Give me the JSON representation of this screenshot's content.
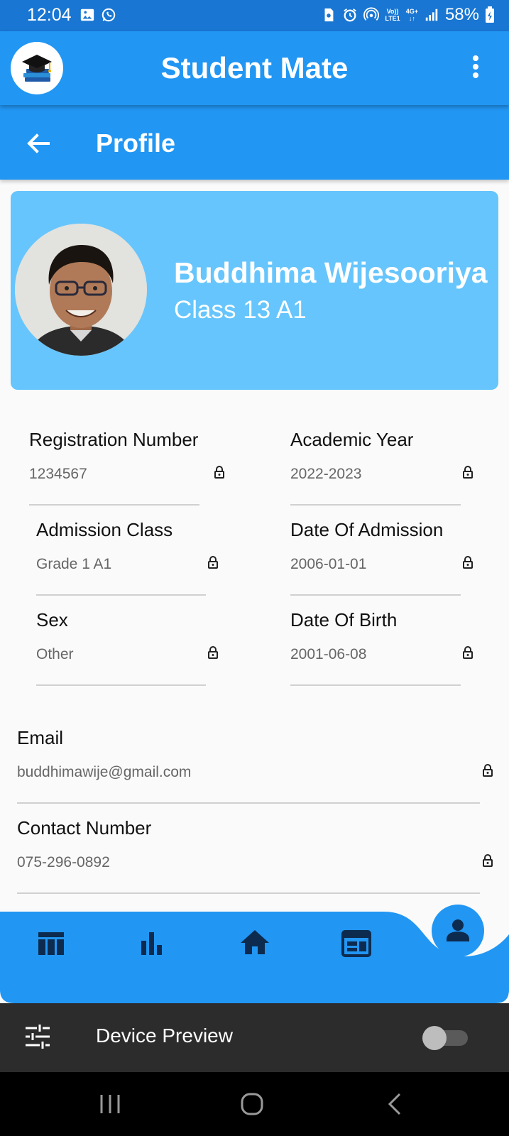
{
  "status_bar": {
    "time": "12:04",
    "left_icons": [
      "gallery-icon",
      "whatsapp-icon"
    ],
    "right_icons": [
      "sim-icon",
      "alarm-icon",
      "hotspot-icon",
      "volte-icon",
      "network-4g-icon",
      "signal-icon"
    ],
    "volte_label_top": "Vo))",
    "volte_label_bottom": "LTE1",
    "network_label": "4G+",
    "battery": "58%"
  },
  "app_bar": {
    "title": "Student Mate",
    "logo_icon": "graduation-cap-books-icon",
    "menu_icon": "more-vert-icon"
  },
  "profile_bar": {
    "title": "Profile",
    "back_icon": "arrow-back-icon"
  },
  "profile_card": {
    "name": "Buddhima Wijesooriya",
    "class": "Class 13 A1",
    "background": "#66c5fc"
  },
  "fields": {
    "registration_number": {
      "label": "Registration Number",
      "value": "1234567"
    },
    "academic_year": {
      "label": "Academic Year",
      "value": "2022-2023"
    },
    "admission_class": {
      "label": "Admission Class",
      "value": "Grade 1 A1"
    },
    "date_of_admission": {
      "label": "Date Of Admission",
      "value": "2006-01-01"
    },
    "sex": {
      "label": "Sex",
      "value": "Other"
    },
    "date_of_birth": {
      "label": "Date Of Birth",
      "value": "2001-06-08"
    },
    "email": {
      "label": "Email",
      "value": "buddhimawije@gmail.com"
    },
    "contact_number": {
      "label": "Contact Number",
      "value": "075-296-0892"
    }
  },
  "bottom_nav": {
    "items": [
      "table-icon",
      "bar-chart-icon",
      "home-icon",
      "calendar-icon",
      "person-icon"
    ],
    "active": "person-icon",
    "color": "#2196f3",
    "icon_color": "#0d2b4f"
  },
  "device_preview": {
    "label": "Device Preview",
    "icon": "tune-icon",
    "toggle_on": false
  },
  "system_nav": [
    "recents-button",
    "home-button",
    "back-button"
  ],
  "colors": {
    "primary": "#2196f3",
    "status_bar": "#1976d2",
    "card": "#66c5fc",
    "device_bar": "#2c2c2c"
  }
}
